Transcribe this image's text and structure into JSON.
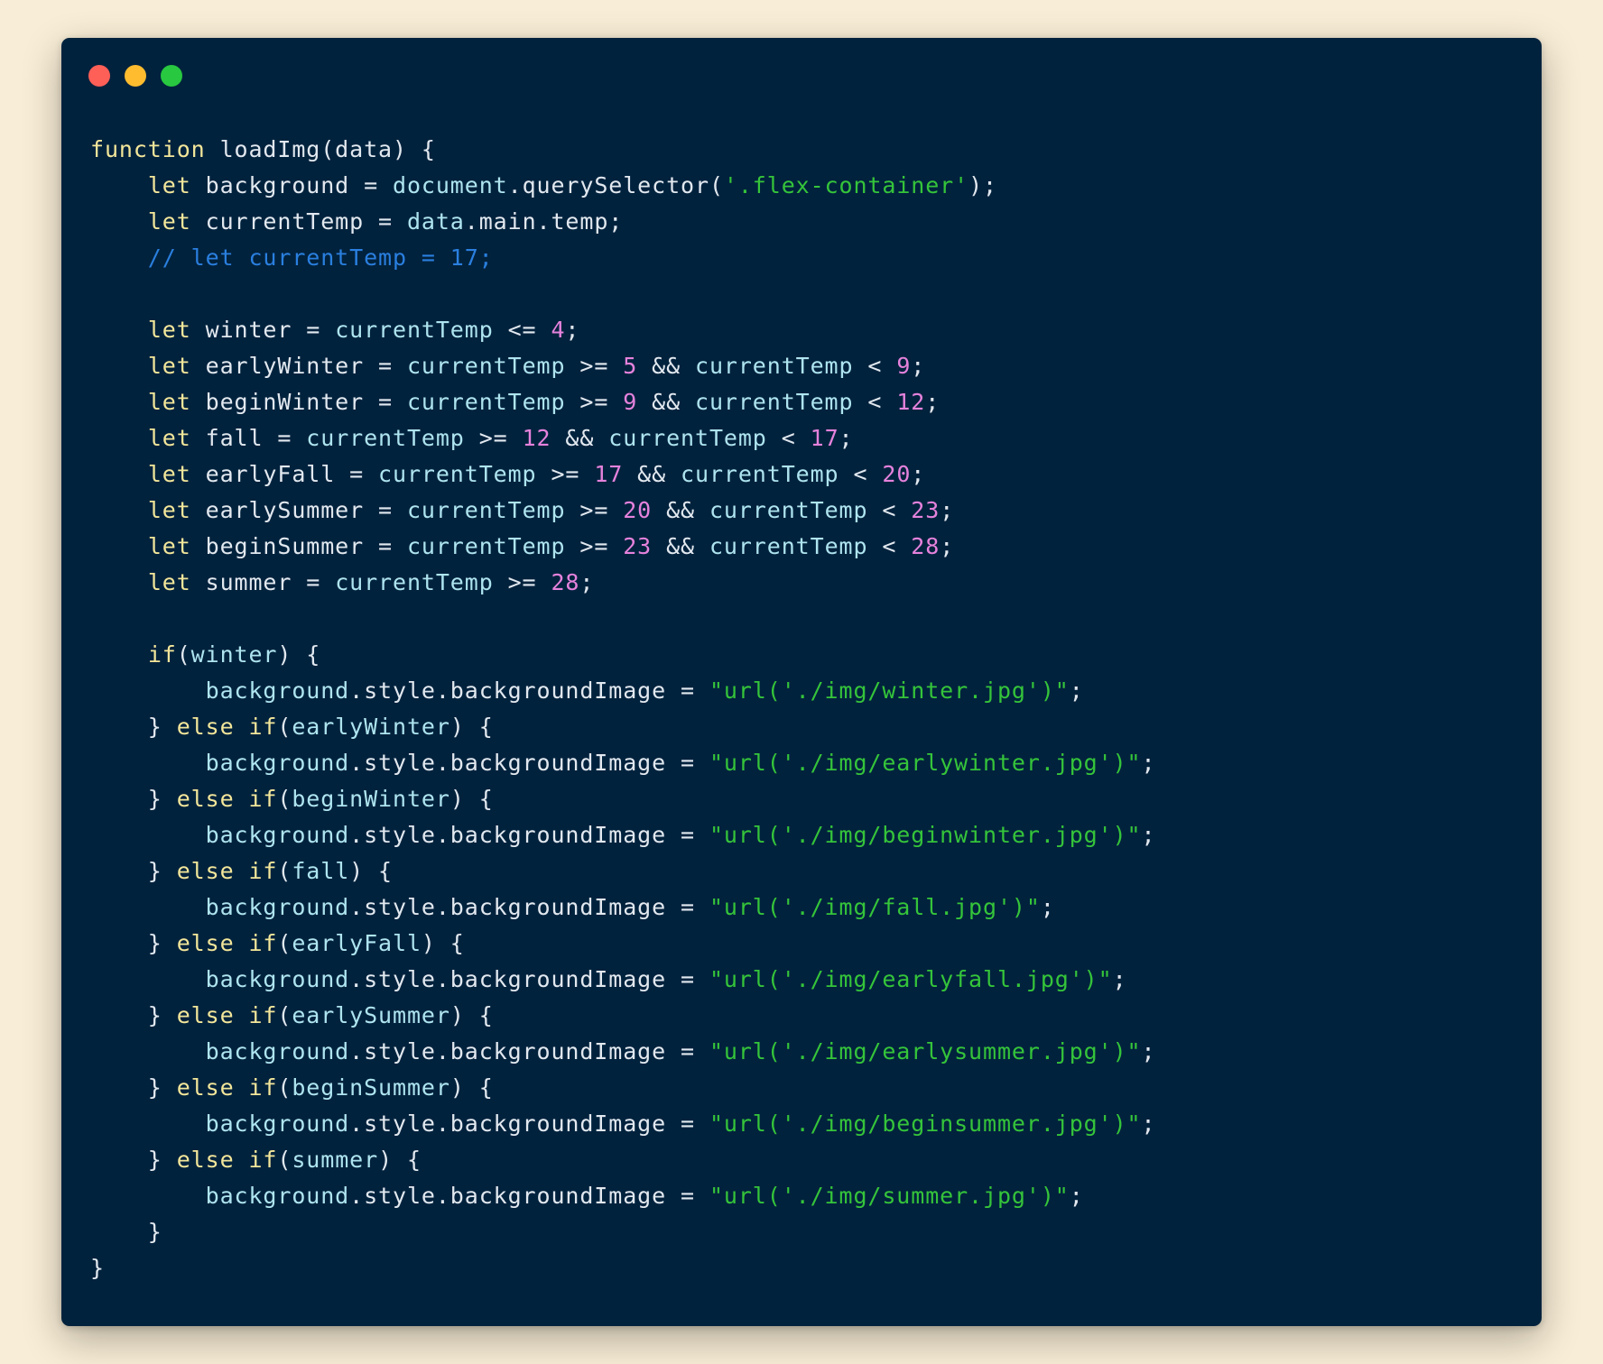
{
  "window": {
    "traffic_lights": [
      {
        "name": "close",
        "color": "#fe5f57"
      },
      {
        "name": "minimize",
        "color": "#febc2e"
      },
      {
        "name": "maximize",
        "color": "#28c840"
      }
    ]
  },
  "colors": {
    "page_background": "#f8edd6",
    "editor_background": "#01223d",
    "keyword": "#f3e69a",
    "plain": "#e2e8ef",
    "identifier": "#aee4ef",
    "string": "#35c43a",
    "number": "#e582dc",
    "comment": "#2a7fdf"
  },
  "code": {
    "language": "javascript",
    "lines": [
      [
        [
          "kw",
          "function"
        ],
        [
          "pl",
          " loadImg(data) {"
        ]
      ],
      [
        [
          "pl",
          "    "
        ],
        [
          "kw",
          "let"
        ],
        [
          "pl",
          " background = "
        ],
        [
          "var",
          "document"
        ],
        [
          "pl",
          ".querySelector("
        ],
        [
          "str",
          "'.flex-container'"
        ],
        [
          "pl",
          ");"
        ]
      ],
      [
        [
          "pl",
          "    "
        ],
        [
          "kw",
          "let"
        ],
        [
          "pl",
          " currentTemp = "
        ],
        [
          "var",
          "data"
        ],
        [
          "pl",
          ".main.temp;"
        ]
      ],
      [
        [
          "cm",
          "    // let currentTemp = 17;"
        ]
      ],
      [],
      [
        [
          "pl",
          "    "
        ],
        [
          "kw",
          "let"
        ],
        [
          "pl",
          " winter = "
        ],
        [
          "var",
          "currentTemp"
        ],
        [
          "pl",
          " <= "
        ],
        [
          "num",
          "4"
        ],
        [
          "pl",
          ";"
        ]
      ],
      [
        [
          "pl",
          "    "
        ],
        [
          "kw",
          "let"
        ],
        [
          "pl",
          " earlyWinter = "
        ],
        [
          "var",
          "currentTemp"
        ],
        [
          "pl",
          " >= "
        ],
        [
          "num",
          "5"
        ],
        [
          "pl",
          " && "
        ],
        [
          "var",
          "currentTemp"
        ],
        [
          "pl",
          " < "
        ],
        [
          "num",
          "9"
        ],
        [
          "pl",
          ";"
        ]
      ],
      [
        [
          "pl",
          "    "
        ],
        [
          "kw",
          "let"
        ],
        [
          "pl",
          " beginWinter = "
        ],
        [
          "var",
          "currentTemp"
        ],
        [
          "pl",
          " >= "
        ],
        [
          "num",
          "9"
        ],
        [
          "pl",
          " && "
        ],
        [
          "var",
          "currentTemp"
        ],
        [
          "pl",
          " < "
        ],
        [
          "num",
          "12"
        ],
        [
          "pl",
          ";"
        ]
      ],
      [
        [
          "pl",
          "    "
        ],
        [
          "kw",
          "let"
        ],
        [
          "pl",
          " fall = "
        ],
        [
          "var",
          "currentTemp"
        ],
        [
          "pl",
          " >= "
        ],
        [
          "num",
          "12"
        ],
        [
          "pl",
          " && "
        ],
        [
          "var",
          "currentTemp"
        ],
        [
          "pl",
          " < "
        ],
        [
          "num",
          "17"
        ],
        [
          "pl",
          ";"
        ]
      ],
      [
        [
          "pl",
          "    "
        ],
        [
          "kw",
          "let"
        ],
        [
          "pl",
          " earlyFall = "
        ],
        [
          "var",
          "currentTemp"
        ],
        [
          "pl",
          " >= "
        ],
        [
          "num",
          "17"
        ],
        [
          "pl",
          " && "
        ],
        [
          "var",
          "currentTemp"
        ],
        [
          "pl",
          " < "
        ],
        [
          "num",
          "20"
        ],
        [
          "pl",
          ";"
        ]
      ],
      [
        [
          "pl",
          "    "
        ],
        [
          "kw",
          "let"
        ],
        [
          "pl",
          " earlySummer = "
        ],
        [
          "var",
          "currentTemp"
        ],
        [
          "pl",
          " >= "
        ],
        [
          "num",
          "20"
        ],
        [
          "pl",
          " && "
        ],
        [
          "var",
          "currentTemp"
        ],
        [
          "pl",
          " < "
        ],
        [
          "num",
          "23"
        ],
        [
          "pl",
          ";"
        ]
      ],
      [
        [
          "pl",
          "    "
        ],
        [
          "kw",
          "let"
        ],
        [
          "pl",
          " beginSummer = "
        ],
        [
          "var",
          "currentTemp"
        ],
        [
          "pl",
          " >= "
        ],
        [
          "num",
          "23"
        ],
        [
          "pl",
          " && "
        ],
        [
          "var",
          "currentTemp"
        ],
        [
          "pl",
          " < "
        ],
        [
          "num",
          "28"
        ],
        [
          "pl",
          ";"
        ]
      ],
      [
        [
          "pl",
          "    "
        ],
        [
          "kw",
          "let"
        ],
        [
          "pl",
          " summer = "
        ],
        [
          "var",
          "currentTemp"
        ],
        [
          "pl",
          " >= "
        ],
        [
          "num",
          "28"
        ],
        [
          "pl",
          ";"
        ]
      ],
      [],
      [
        [
          "pl",
          "    "
        ],
        [
          "kw",
          "if"
        ],
        [
          "pl",
          "("
        ],
        [
          "var",
          "winter"
        ],
        [
          "pl",
          ") {"
        ]
      ],
      [
        [
          "pl",
          "        "
        ],
        [
          "var",
          "background"
        ],
        [
          "pl",
          ".style.backgroundImage = "
        ],
        [
          "str",
          "\"url('./img/winter.jpg')\""
        ],
        [
          "pl",
          ";"
        ]
      ],
      [
        [
          "pl",
          "    } "
        ],
        [
          "kw",
          "else if"
        ],
        [
          "pl",
          "("
        ],
        [
          "var",
          "earlyWinter"
        ],
        [
          "pl",
          ") {"
        ]
      ],
      [
        [
          "pl",
          "        "
        ],
        [
          "var",
          "background"
        ],
        [
          "pl",
          ".style.backgroundImage = "
        ],
        [
          "str",
          "\"url('./img/earlywinter.jpg')\""
        ],
        [
          "pl",
          ";"
        ]
      ],
      [
        [
          "pl",
          "    } "
        ],
        [
          "kw",
          "else if"
        ],
        [
          "pl",
          "("
        ],
        [
          "var",
          "beginWinter"
        ],
        [
          "pl",
          ") {"
        ]
      ],
      [
        [
          "pl",
          "        "
        ],
        [
          "var",
          "background"
        ],
        [
          "pl",
          ".style.backgroundImage = "
        ],
        [
          "str",
          "\"url('./img/beginwinter.jpg')\""
        ],
        [
          "pl",
          ";"
        ]
      ],
      [
        [
          "pl",
          "    } "
        ],
        [
          "kw",
          "else if"
        ],
        [
          "pl",
          "("
        ],
        [
          "var",
          "fall"
        ],
        [
          "pl",
          ") {"
        ]
      ],
      [
        [
          "pl",
          "        "
        ],
        [
          "var",
          "background"
        ],
        [
          "pl",
          ".style.backgroundImage = "
        ],
        [
          "str",
          "\"url('./img/fall.jpg')\""
        ],
        [
          "pl",
          ";"
        ]
      ],
      [
        [
          "pl",
          "    } "
        ],
        [
          "kw",
          "else if"
        ],
        [
          "pl",
          "("
        ],
        [
          "var",
          "earlyFall"
        ],
        [
          "pl",
          ") {"
        ]
      ],
      [
        [
          "pl",
          "        "
        ],
        [
          "var",
          "background"
        ],
        [
          "pl",
          ".style.backgroundImage = "
        ],
        [
          "str",
          "\"url('./img/earlyfall.jpg')\""
        ],
        [
          "pl",
          ";"
        ]
      ],
      [
        [
          "pl",
          "    } "
        ],
        [
          "kw",
          "else if"
        ],
        [
          "pl",
          "("
        ],
        [
          "var",
          "earlySummer"
        ],
        [
          "pl",
          ") {"
        ]
      ],
      [
        [
          "pl",
          "        "
        ],
        [
          "var",
          "background"
        ],
        [
          "pl",
          ".style.backgroundImage = "
        ],
        [
          "str",
          "\"url('./img/earlysummer.jpg')\""
        ],
        [
          "pl",
          ";"
        ]
      ],
      [
        [
          "pl",
          "    } "
        ],
        [
          "kw",
          "else if"
        ],
        [
          "pl",
          "("
        ],
        [
          "var",
          "beginSummer"
        ],
        [
          "pl",
          ") {"
        ]
      ],
      [
        [
          "pl",
          "        "
        ],
        [
          "var",
          "background"
        ],
        [
          "pl",
          ".style.backgroundImage = "
        ],
        [
          "str",
          "\"url('./img/beginsummer.jpg')\""
        ],
        [
          "pl",
          ";"
        ]
      ],
      [
        [
          "pl",
          "    } "
        ],
        [
          "kw",
          "else if"
        ],
        [
          "pl",
          "("
        ],
        [
          "var",
          "summer"
        ],
        [
          "pl",
          ") {"
        ]
      ],
      [
        [
          "pl",
          "        "
        ],
        [
          "var",
          "background"
        ],
        [
          "pl",
          ".style.backgroundImage = "
        ],
        [
          "str",
          "\"url('./img/summer.jpg')\""
        ],
        [
          "pl",
          ";"
        ]
      ],
      [
        [
          "pl",
          "    }"
        ]
      ],
      [
        [
          "pl",
          "}"
        ]
      ]
    ]
  }
}
